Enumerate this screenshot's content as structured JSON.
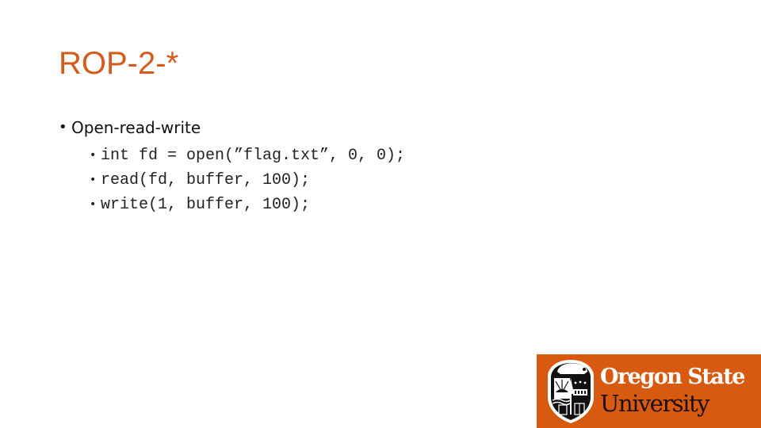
{
  "slide": {
    "title": "ROP-2-*",
    "bullets": [
      {
        "bullet_glyph": "•",
        "text": "Open-read-write",
        "children": [
          {
            "bullet_glyph": "•",
            "text": "int fd = open(”flag.txt”, 0, 0);"
          },
          {
            "bullet_glyph": "•",
            "text": "read(fd, buffer, 100);"
          },
          {
            "bullet_glyph": "•",
            "text": "write(1, buffer, 100);"
          }
        ]
      }
    ]
  },
  "logo": {
    "line1": "Oregon State",
    "line2": "University",
    "emblem_icon": "osu-shield-beaver-icon",
    "background_color": "#d85a10"
  },
  "colors": {
    "title": "#d35b1c",
    "body_text": "#111111"
  }
}
